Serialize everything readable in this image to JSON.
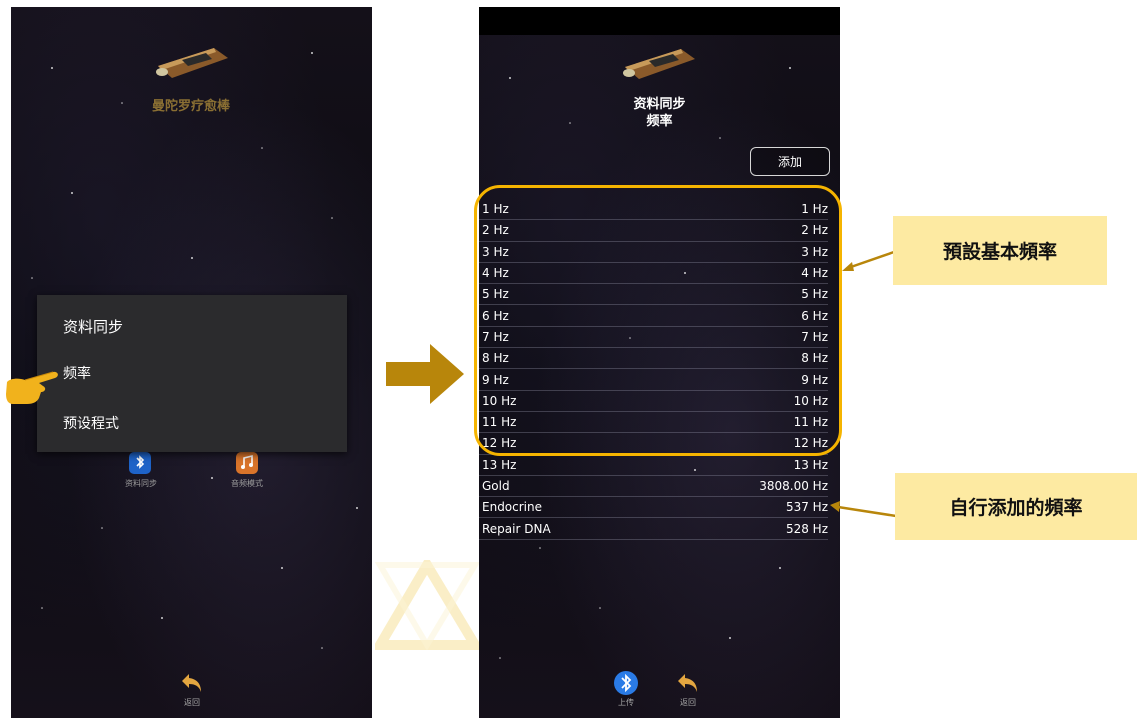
{
  "left_screen": {
    "app_title": "曼陀罗疗愈棒",
    "dialog": {
      "title": "资料同步",
      "items": [
        {
          "label": "频率"
        },
        {
          "label": "预设程式"
        }
      ]
    },
    "home_items": [
      {
        "label": "资料同步",
        "icon": "bluetooth-icon"
      },
      {
        "label": "音频模式",
        "icon": "music-icon"
      }
    ],
    "bottom_nav": {
      "back_label": "返回"
    }
  },
  "right_screen": {
    "title_line1": "资料同步",
    "title_line2": "频率",
    "add_button": "添加",
    "frequencies": [
      {
        "name": "1 Hz",
        "value": "1 Hz"
      },
      {
        "name": "2 Hz",
        "value": "2 Hz"
      },
      {
        "name": "3 Hz",
        "value": "3 Hz"
      },
      {
        "name": "4 Hz",
        "value": "4 Hz"
      },
      {
        "name": "5 Hz",
        "value": "5 Hz"
      },
      {
        "name": "6 Hz",
        "value": "6 Hz"
      },
      {
        "name": "7 Hz",
        "value": "7 Hz"
      },
      {
        "name": "8 Hz",
        "value": "8 Hz"
      },
      {
        "name": "9 Hz",
        "value": "9 Hz"
      },
      {
        "name": "10 Hz",
        "value": "10 Hz"
      },
      {
        "name": "11 Hz",
        "value": "11 Hz"
      },
      {
        "name": "12 Hz",
        "value": "12 Hz"
      },
      {
        "name": "13 Hz",
        "value": "13 Hz"
      },
      {
        "name": "Gold",
        "value": "3808.00 Hz"
      },
      {
        "name": "Endocrine",
        "value": "537 Hz"
      },
      {
        "name": "Repair DNA",
        "value": "528 Hz"
      }
    ],
    "bottom_nav": {
      "upload_label": "上传",
      "back_label": "返回"
    }
  },
  "annotations": {
    "preset_callout": "預設基本頻率",
    "custom_callout": "自行添加的頻率"
  },
  "colors": {
    "highlight": "#f5b400",
    "callout_bg": "#fdeaa2",
    "arrow": "#b8860b",
    "title_gold": "#8a6f33"
  }
}
